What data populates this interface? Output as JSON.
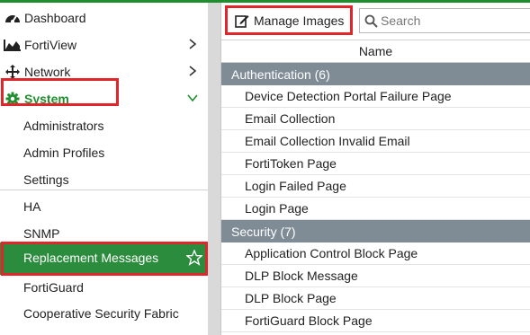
{
  "sidebar": {
    "items": [
      {
        "label": "Dashboard",
        "icon": "dashboard-icon"
      },
      {
        "label": "FortiView",
        "icon": "fortiview-icon"
      },
      {
        "label": "Network",
        "icon": "network-icon"
      },
      {
        "label": "System",
        "icon": "gear-icon"
      }
    ],
    "system_children": [
      "Administrators",
      "Admin Profiles",
      "Settings",
      "HA",
      "SNMP",
      "Replacement Messages",
      "FortiGuard",
      "Cooperative Security Fabric"
    ]
  },
  "toolbar": {
    "manage_images_label": "Manage Images",
    "search_placeholder": "Search"
  },
  "table": {
    "column_header": "Name",
    "groups": [
      {
        "label": "Authentication (6)",
        "rows": [
          "Device Detection Portal Failure Page",
          "Email Collection",
          "Email Collection Invalid Email",
          "FortiToken Page",
          "Login Failed Page",
          "Login Page"
        ]
      },
      {
        "label": "Security (7)",
        "rows": [
          "Application Control Block Page",
          "DLP Block Message",
          "DLP Block Page",
          "FortiGuard Block Page"
        ]
      }
    ]
  },
  "colors": {
    "accent_green": "#1f8f2e",
    "selected_row": "#2a8c3c",
    "highlight_red": "#e0262b",
    "group_header": "#7f8c96"
  }
}
